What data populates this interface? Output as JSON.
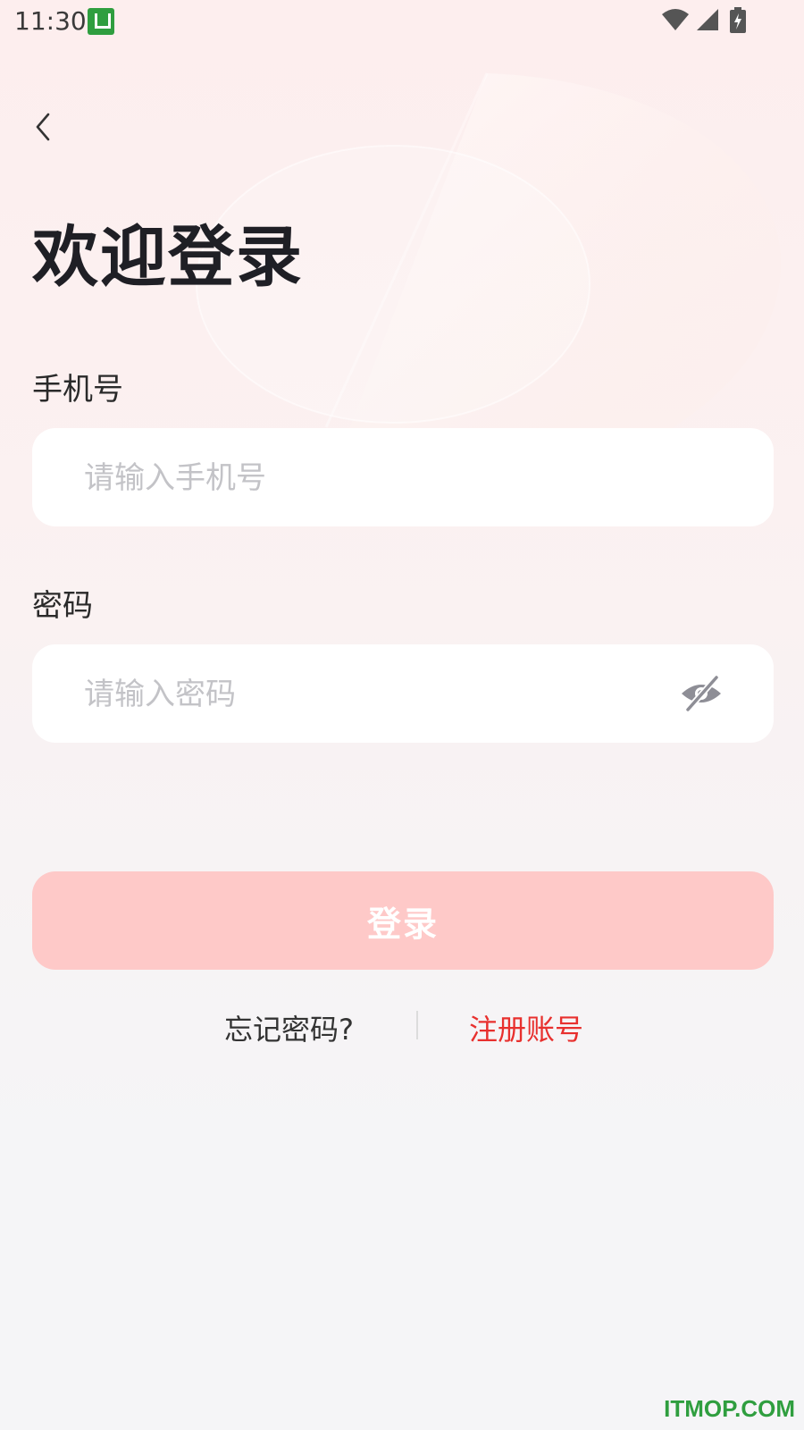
{
  "status_bar": {
    "time": "11:30",
    "app_icon": "green-square-app-icon",
    "icons": [
      "wifi-icon",
      "signal-icon",
      "battery-charging-icon"
    ]
  },
  "nav": {
    "back_icon": "chevron-left-icon"
  },
  "page": {
    "title": "欢迎登录"
  },
  "form": {
    "phone_label": "手机号",
    "phone_placeholder": "请输入手机号",
    "phone_value": "",
    "password_label": "密码",
    "password_placeholder": "请输入密码",
    "password_value": "",
    "password_toggle_icon": "eye-off-icon"
  },
  "actions": {
    "login_label": "登录",
    "forgot_label": "忘记密码?",
    "register_label": "注册账号"
  },
  "watermark": "ITMOP.COM",
  "colors": {
    "accent_red": "#e8302e",
    "login_button_disabled": "#fec9c8",
    "title": "#1f1f25",
    "placeholder": "#c3c3c7",
    "watermark_green": "#2f9e3f"
  }
}
